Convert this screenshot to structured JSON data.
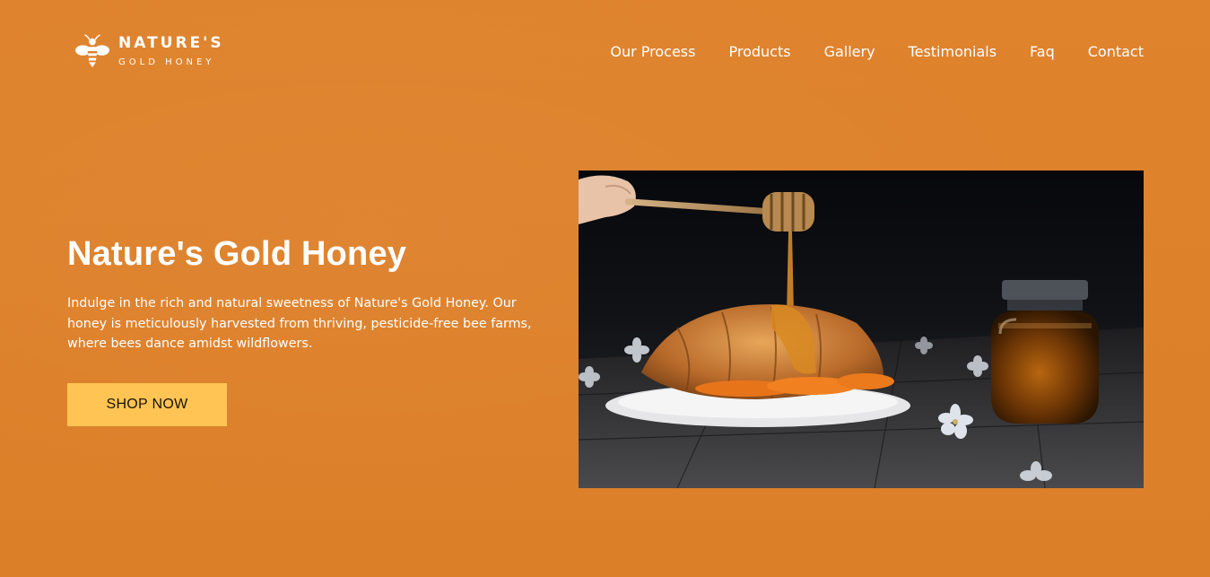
{
  "brand": {
    "name": "NATURE'S",
    "tagline": "GOLD HONEY",
    "logo_icon": "bee-icon"
  },
  "nav": {
    "items": [
      {
        "label": "Our Process"
      },
      {
        "label": "Products"
      },
      {
        "label": "Gallery"
      },
      {
        "label": "Testimonials"
      },
      {
        "label": "Faq"
      },
      {
        "label": "Contact"
      }
    ]
  },
  "hero": {
    "title": "Nature's Gold Honey",
    "description": "Indulge in the rich and natural sweetness of Nature's Gold Honey. Our honey is meticulously harvested from thriving, pesticide-free bee farms, where bees dance amidst wildflowers.",
    "cta_label": "SHOP NOW",
    "image_alt": "honey-croissant-photo"
  },
  "colors": {
    "background": "#de812b",
    "button": "#ffc453",
    "text": "#ffffff"
  }
}
